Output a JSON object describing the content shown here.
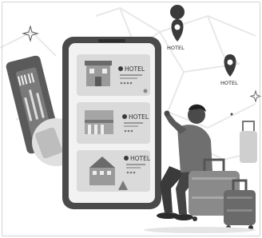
{
  "map_pins": [
    {
      "label": "HOTEL"
    },
    {
      "label": "HOTEL"
    }
  ],
  "phone": {
    "cards": [
      {
        "title": "HOTEL"
      },
      {
        "title": "HOTEL"
      },
      {
        "title": "HOTEL"
      }
    ]
  },
  "colors": {
    "background": "#ffffff",
    "map_lines": "#e6e6e6",
    "phone_body": "#4a4a4a",
    "screen": "#f2f2f2",
    "card": "#dcdcdc",
    "pin": "#3a3a3a",
    "luggage": "#8a8a8a"
  },
  "icons": [
    "sparkle-icon",
    "location-pin-icon",
    "boarding-pass-icon",
    "suitcase-icon",
    "star-icon"
  ]
}
